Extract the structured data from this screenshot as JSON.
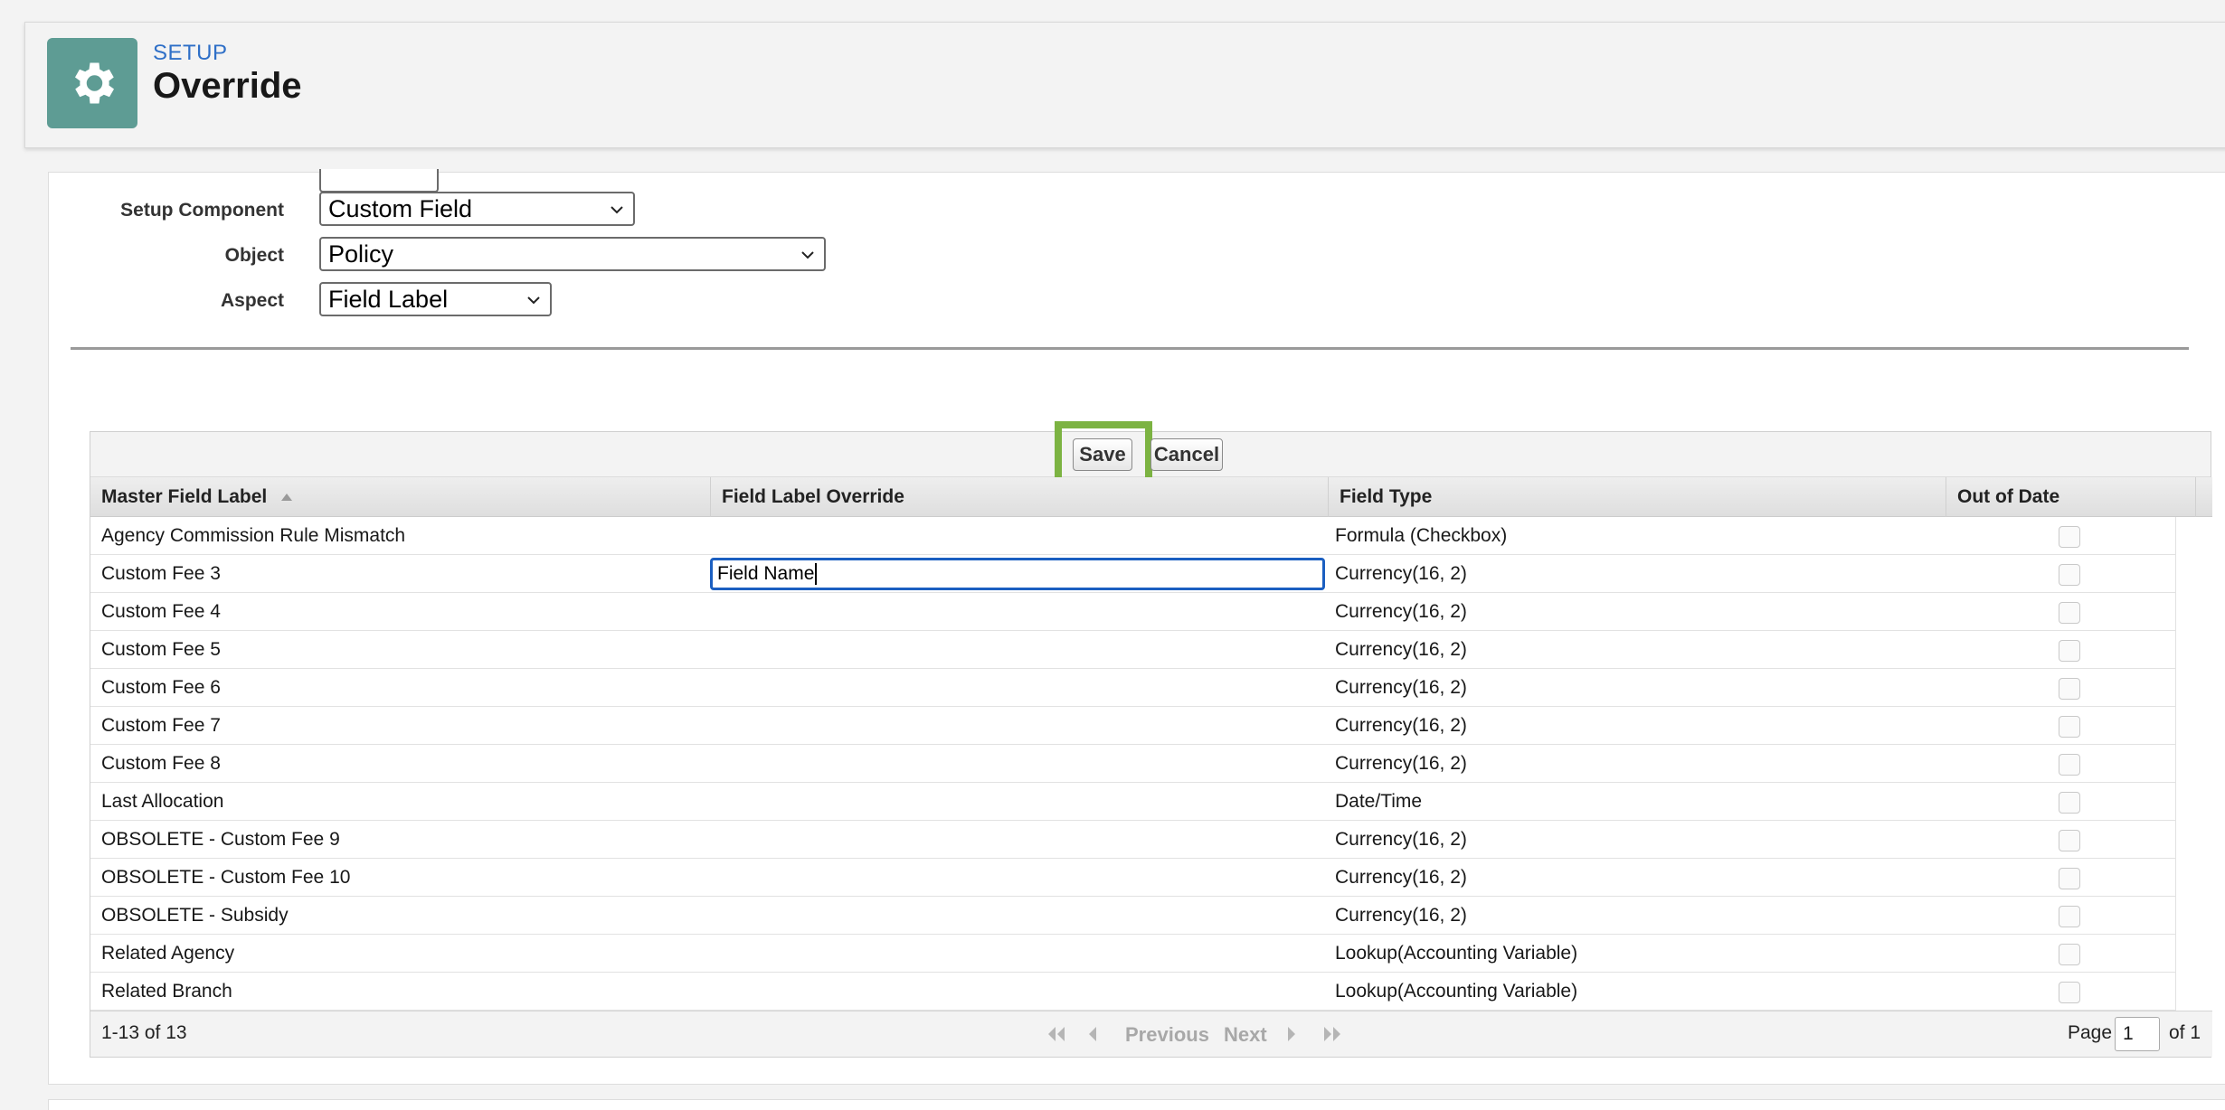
{
  "header": {
    "eyebrow": "SETUP",
    "title": "Override",
    "icon": "gear-icon"
  },
  "filters": {
    "setup_component": {
      "label": "Setup Component",
      "value": "Custom Field"
    },
    "object": {
      "label": "Object",
      "value": "Policy"
    },
    "aspect": {
      "label": "Aspect",
      "value": "Field Label"
    }
  },
  "buttons": {
    "save": "Save",
    "cancel": "Cancel"
  },
  "table": {
    "columns": [
      "Master Field Label",
      "Field Label Override",
      "Field Type",
      "Out of Date"
    ],
    "rows": [
      {
        "label": "Agency Commission Rule Mismatch",
        "override": "",
        "type": "Formula (Checkbox)"
      },
      {
        "label": "Custom Fee 3",
        "override": "Field Name",
        "type": "Currency(16, 2)"
      },
      {
        "label": "Custom Fee 4",
        "override": "",
        "type": "Currency(16, 2)"
      },
      {
        "label": "Custom Fee 5",
        "override": "",
        "type": "Currency(16, 2)"
      },
      {
        "label": "Custom Fee 6",
        "override": "",
        "type": "Currency(16, 2)"
      },
      {
        "label": "Custom Fee 7",
        "override": "",
        "type": "Currency(16, 2)"
      },
      {
        "label": "Custom Fee 8",
        "override": "",
        "type": "Currency(16, 2)"
      },
      {
        "label": "Last Allocation",
        "override": "",
        "type": "Date/Time"
      },
      {
        "label": "OBSOLETE - Custom Fee 9",
        "override": "",
        "type": "Currency(16, 2)"
      },
      {
        "label": "OBSOLETE - Custom Fee 10",
        "override": "",
        "type": "Currency(16, 2)"
      },
      {
        "label": "OBSOLETE - Subsidy",
        "override": "",
        "type": "Currency(16, 2)"
      },
      {
        "label": "Related Agency",
        "override": "",
        "type": "Lookup(Accounting Variable)"
      },
      {
        "label": "Related Branch",
        "override": "",
        "type": "Lookup(Accounting Variable)"
      }
    ]
  },
  "footer": {
    "count": "1-13 of 13",
    "previous": "Previous",
    "next": "Next",
    "page_label": "Page",
    "page_value": "1",
    "page_total": "of 1"
  },
  "colors": {
    "accent": "#2e6fc7",
    "header_icon_bg": "#5e9c94",
    "highlight": "#7cb342",
    "focus_border": "#1b5fc1"
  }
}
